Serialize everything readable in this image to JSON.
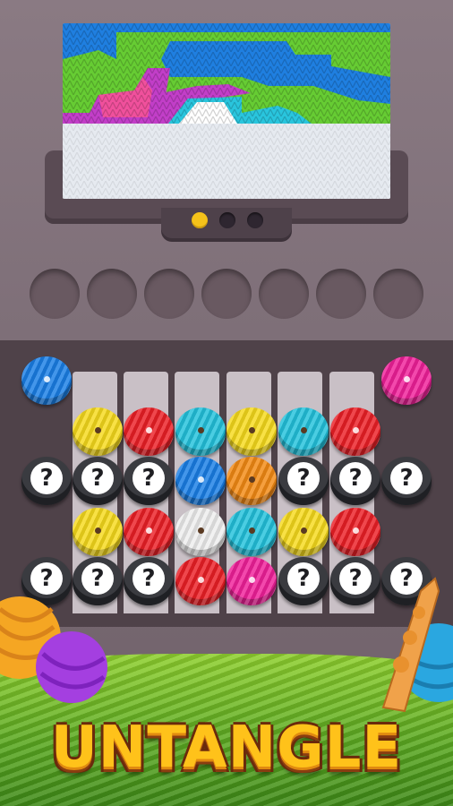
{
  "title": "UNTANGLE",
  "pagination": {
    "pages": 3,
    "current": 1
  },
  "slots": {
    "count": 7
  },
  "picture": {
    "description_colors": {
      "blue": "#1f7fe0",
      "green": "#66cc33",
      "magenta": "#c23ec8",
      "pink": "#f0509c",
      "white": "#ffffff",
      "cyan": "#29c5dd",
      "background": "#e6eaf0"
    }
  },
  "colors": {
    "blue": "#1a7fe6",
    "pink": "#f0209a",
    "yellow": "#f6da1c",
    "red": "#ec1f26",
    "cyan": "#22c2dc",
    "orange": "#f38a14",
    "white": "#eeeeee",
    "hidden": "#3a3b40"
  },
  "grid": {
    "rows": [
      [
        "blue",
        null,
        null,
        null,
        null,
        null,
        null,
        "pink"
      ],
      [
        null,
        "yellow",
        "red",
        "cyan",
        "yellow",
        "cyan",
        "red",
        null
      ],
      [
        "hidden",
        "hidden",
        "hidden",
        "blue",
        "orange",
        "hidden",
        "hidden",
        "hidden"
      ],
      [
        null,
        "yellow",
        "red",
        "white",
        "cyan",
        "yellow",
        "red",
        null
      ],
      [
        "hidden",
        "hidden",
        "hidden",
        "red",
        "pink",
        "hidden",
        "hidden",
        "hidden"
      ]
    ],
    "hidden_mark": "?"
  }
}
